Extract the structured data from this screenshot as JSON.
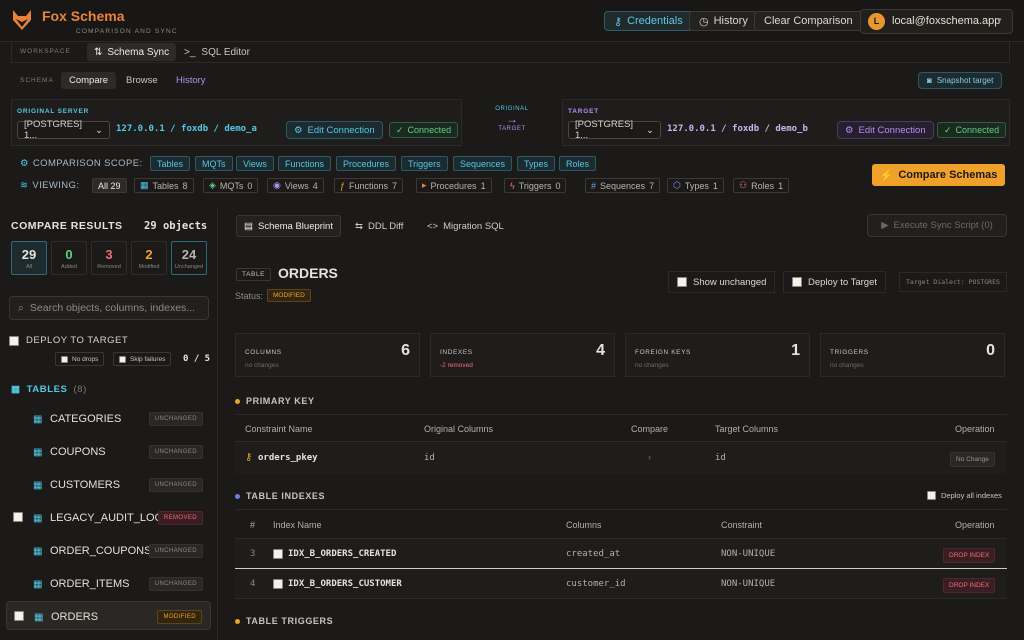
{
  "app": {
    "name": "Fox Schema",
    "subtitle": "COMPARISON AND SYNC"
  },
  "header": {
    "credentials": "Credentials",
    "history": "History",
    "clear": "Clear Comparison",
    "avatar": "L",
    "account": "local@foxschema.app"
  },
  "workspace": {
    "label": "WORKSPACE",
    "tabs": [
      {
        "label": "Schema Sync",
        "active": true
      },
      {
        "label": "SQL Editor",
        "active": false
      }
    ]
  },
  "schema_bar": {
    "label": "SCHEMA",
    "tabs": [
      "Compare",
      "Browse",
      "History"
    ],
    "active": "Compare",
    "snapshot": "Snapshot target"
  },
  "original": {
    "label": "ORIGINAL SERVER",
    "select": "[POSTGRES] 1...",
    "host": "127.0.0.1 / foxdb / demo_a",
    "edit": "Edit Connection",
    "status": "Connected"
  },
  "swap": {
    "top": "ORIGINAL",
    "bottom": "TARGET"
  },
  "target": {
    "label": "TARGET",
    "select": "[POSTGRES] 1...",
    "host": "127.0.0.1 / foxdb / demo_b",
    "edit": "Edit Connection",
    "status": "Connected"
  },
  "scope": {
    "label": "COMPARISON SCOPE:",
    "chips": [
      "Tables",
      "MQTs",
      "Views",
      "Functions",
      "Procedures",
      "Triggers",
      "Sequences",
      "Types",
      "Roles"
    ]
  },
  "viewing": {
    "label": "VIEWING:",
    "all": "All 29",
    "items": [
      {
        "label": "Tables",
        "count": "8",
        "icon": "table-icon",
        "color": "#53c8e4"
      },
      {
        "label": "MQTs",
        "count": "0",
        "icon": "layers-icon",
        "color": "#5fcf84"
      },
      {
        "label": "Views",
        "count": "4",
        "icon": "eye-icon",
        "color": "#b48ef0"
      },
      {
        "label": "Functions",
        "count": "7",
        "icon": "function-icon",
        "color": "#f0a12a"
      },
      {
        "label": "Procedures",
        "count": "1",
        "icon": "procedure-icon",
        "color": "#e8833a"
      },
      {
        "label": "Triggers",
        "count": "0",
        "icon": "bolt-icon",
        "color": "#f06b7b"
      },
      {
        "label": "Sequences",
        "count": "7",
        "icon": "hash-icon",
        "color": "#5aa9f0"
      },
      {
        "label": "Types",
        "count": "1",
        "icon": "cube-icon",
        "color": "#8f8ef0"
      },
      {
        "label": "Roles",
        "count": "1",
        "icon": "users-icon",
        "color": "#e87aa8"
      }
    ]
  },
  "compare_button": "Compare Schemas",
  "results": {
    "title": "COMPARE RESULTS",
    "count": "29 objects",
    "stats": [
      {
        "value": "29",
        "label": "All",
        "color": "#5ec7e8"
      },
      {
        "value": "0",
        "label": "Added",
        "color": "#5fcf84"
      },
      {
        "value": "3",
        "label": "Removed",
        "color": "#f06b7b"
      },
      {
        "value": "2",
        "label": "Modified",
        "color": "#f0a12a"
      },
      {
        "value": "24",
        "label": "Unchanged",
        "color": "#b9b4ab"
      }
    ],
    "search_placeholder": "Search objects, columns, indexes...",
    "deploy_label": "DEPLOY TO TARGET",
    "no_drops": "No drops",
    "skip_failures": "Skip failures",
    "deploy_count": "0 / 5",
    "tables_label": "TABLES",
    "tables_count": "(8)",
    "tables": [
      {
        "name": "CATEGORIES",
        "status": "UNCHANGED",
        "checkbox": false
      },
      {
        "name": "COUPONS",
        "status": "UNCHANGED",
        "checkbox": false
      },
      {
        "name": "CUSTOMERS",
        "status": "UNCHANGED",
        "checkbox": false
      },
      {
        "name": "LEGACY_AUDIT_LOG",
        "status": "REMOVED",
        "checkbox": true
      },
      {
        "name": "ORDER_COUPONS",
        "status": "UNCHANGED",
        "checkbox": false
      },
      {
        "name": "ORDER_ITEMS",
        "status": "UNCHANGED",
        "checkbox": false
      },
      {
        "name": "ORDERS",
        "status": "MODIFIED",
        "checkbox": true,
        "selected": true
      }
    ]
  },
  "detail": {
    "tabs": [
      "Schema Blueprint",
      "DDL Diff",
      "Migration SQL"
    ],
    "exec": "Execute Sync Script (0)",
    "tag": "TABLE",
    "name": "ORDERS",
    "status_label": "Status:",
    "status": "MODIFIED",
    "show_unchanged": "Show unchanged",
    "deploy_target": "Deploy to Target",
    "dialect": "Target Dialect: POSTGRES",
    "cards": [
      {
        "label": "COLUMNS",
        "sub": "no changes",
        "value": "6"
      },
      {
        "label": "INDEXES",
        "sub": "-2 removed",
        "value": "4"
      },
      {
        "label": "FOREIGN KEYS",
        "sub": "no changes",
        "value": "1"
      },
      {
        "label": "TRIGGERS",
        "sub": "no changes",
        "value": "0"
      }
    ],
    "pk": {
      "title": "PRIMARY KEY",
      "headers": [
        "Constraint Name",
        "Original Columns",
        "Compare",
        "Target Columns",
        "Operation"
      ],
      "row": {
        "name": "orders_pkey",
        "orig": "id",
        "arrow": "›",
        "target": "id",
        "op": "No Change"
      }
    },
    "indexes": {
      "title": "TABLE INDEXES",
      "deploy_all": "Deploy all indexes",
      "headers": [
        "#",
        "Index Name",
        "Columns",
        "Constraint",
        "Operation"
      ],
      "rows": [
        {
          "n": "3",
          "name": "IDX_B_ORDERS_CREATED",
          "cols": "created_at",
          "constraint": "NON-UNIQUE",
          "op": "DROP INDEX"
        },
        {
          "n": "4",
          "name": "IDX_B_ORDERS_CUSTOMER",
          "cols": "customer_id",
          "constraint": "NON-UNIQUE",
          "op": "DROP INDEX"
        }
      ]
    },
    "triggers_title": "TABLE TRIGGERS"
  }
}
